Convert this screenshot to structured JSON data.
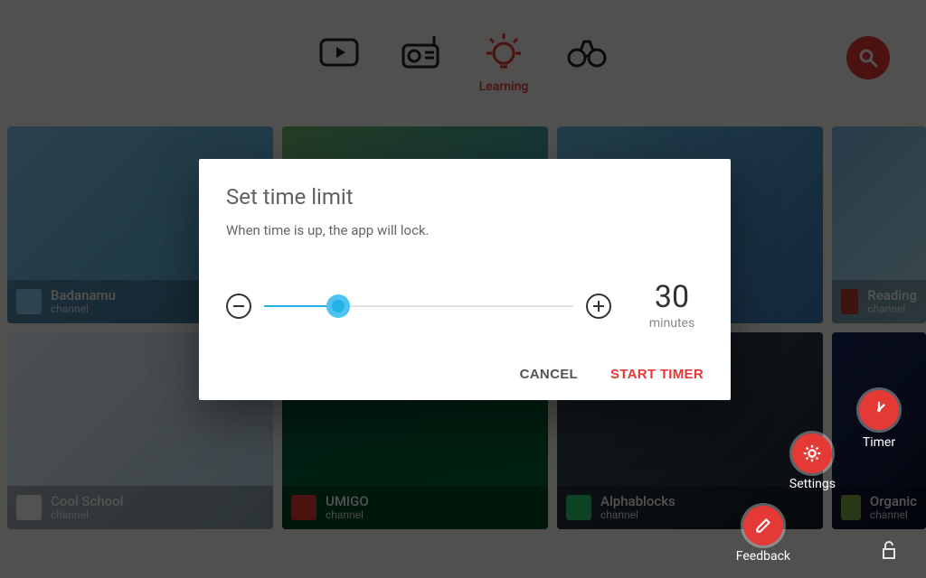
{
  "nav": {
    "active_label": "Learning"
  },
  "dialog": {
    "title": "Set time limit",
    "description": "When time is up, the app will lock.",
    "value": "30",
    "unit": "minutes",
    "cancel": "CANCEL",
    "start": "START TIMER"
  },
  "fabs": {
    "timer": "Timer",
    "settings": "Settings",
    "feedback": "Feedback"
  },
  "cards": [
    {
      "title": "Badanamu",
      "sub": "channel"
    },
    {
      "title": "",
      "sub": ""
    },
    {
      "title": "",
      "sub": ""
    },
    {
      "title": "Reading",
      "sub": "channel"
    },
    {
      "title": "Cool School",
      "sub": "channel"
    },
    {
      "title": "UMIGO",
      "sub": "channel"
    },
    {
      "title": "Alphablocks",
      "sub": "channel"
    },
    {
      "title": "Organic",
      "sub": "channel"
    }
  ]
}
